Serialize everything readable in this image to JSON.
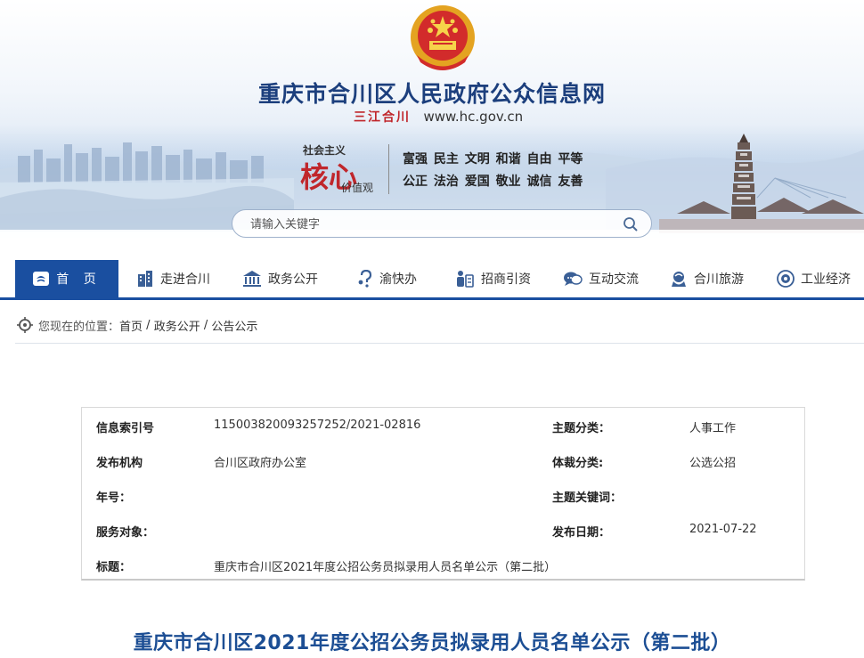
{
  "site": {
    "title": "重庆市合川区人民政府公众信息网",
    "calligraphy": "三江合川",
    "url": "www.hc.gov.cn"
  },
  "core_values": {
    "left_top": "社会主义",
    "left_big": "核心",
    "left_bottom": "价值观",
    "row1": "富强 民主 文明 和谐 自由 平等",
    "row2": "公正 法治 爱国 敬业 诚信 友善"
  },
  "search": {
    "placeholder": "请输入关键字"
  },
  "nav": {
    "items": [
      {
        "label": "首 页",
        "icon": "home-icon"
      },
      {
        "label": "走进合川",
        "icon": "building-icon"
      },
      {
        "label": "政务公开",
        "icon": "government-building-icon"
      },
      {
        "label": "渝快办",
        "icon": "question-person-icon"
      },
      {
        "label": "招商引资",
        "icon": "investment-icon"
      },
      {
        "label": "互动交流",
        "icon": "chat-icon"
      },
      {
        "label": "合川旅游",
        "icon": "travel-icon"
      },
      {
        "label": "工业经济",
        "icon": "gear-icon"
      }
    ]
  },
  "breadcrumb": {
    "lead": "您现在的位置：",
    "path": [
      "首页",
      "政务公开",
      "公告公示"
    ],
    "sep": " / "
  },
  "info_table": {
    "index_label": "信息索引号",
    "index_value": "115003820093257252/2021-02816",
    "topic_label": "主题分类：",
    "topic_value": "人事工作",
    "org_label": "发布机构",
    "org_value": "合川区政府办公室",
    "genre_label": "体裁分类:",
    "genre_value": "公选公招",
    "year_label": "年号：",
    "year_value": "",
    "keywords_label": "主题关键词：",
    "keywords_value": "",
    "audience_label": "服务对象：",
    "audience_value": "",
    "date_label": "发布日期：",
    "date_value": "2021-07-22",
    "title_label": "标题：",
    "title_value": "重庆市合川区2021年度公招公务员拟录用人员名单公示（第二批）"
  },
  "article": {
    "title": "重庆市合川区2021年度公招公务员拟录用人员名单公示（第二批）"
  },
  "colors": {
    "nav_blue": "#1a4fa0",
    "title_blue": "#1c3f7d",
    "red": "#c0262b"
  }
}
